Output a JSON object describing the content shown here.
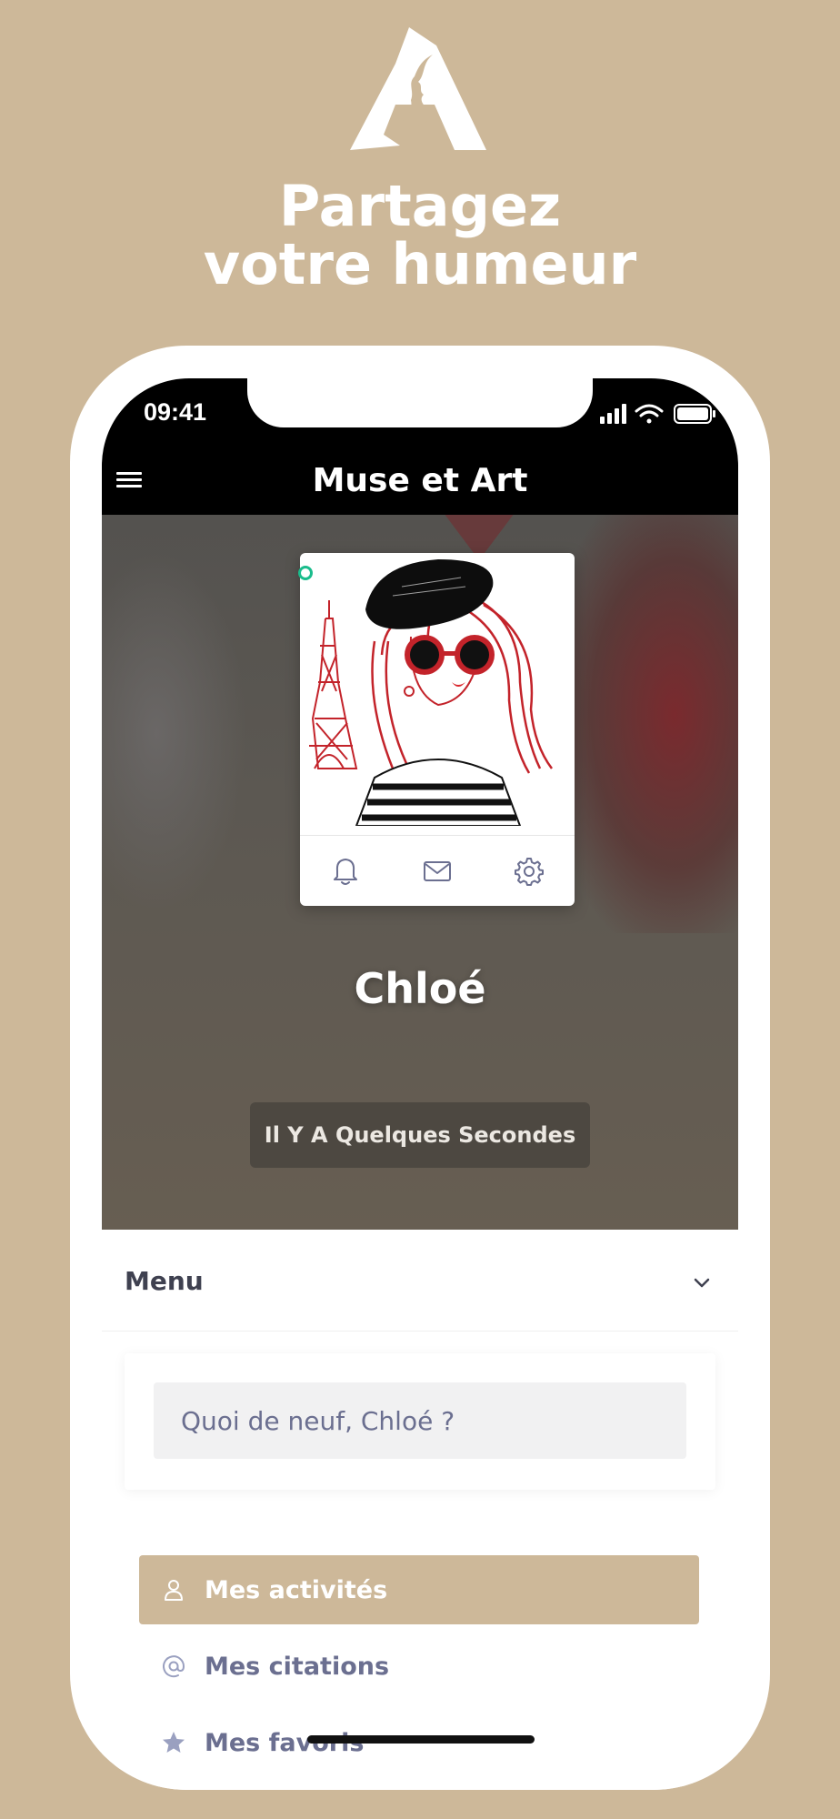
{
  "promo": {
    "headline_line1": "Partagez",
    "headline_line2": "votre humeur"
  },
  "status": {
    "time": "09:41"
  },
  "app": {
    "title": "Muse et Art"
  },
  "profile": {
    "name": "Chloé",
    "last_seen": "Il Y A Quelques Secondes",
    "online": true,
    "online_color": "#1abc8c"
  },
  "card_actions": [
    "bell-icon",
    "mail-icon",
    "gear-icon"
  ],
  "menu": {
    "title": "Menu"
  },
  "post": {
    "placeholder": "Quoi de neuf, Chloé ?"
  },
  "nav": {
    "items": [
      {
        "label": "Mes activités",
        "icon": "user-icon",
        "active": true
      },
      {
        "label": "Mes citations",
        "icon": "at-icon",
        "active": false
      },
      {
        "label": "Mes favoris",
        "icon": "star-icon",
        "active": false
      }
    ]
  },
  "colors": {
    "background": "#cdb899",
    "accent": "#cdb899",
    "muted_text": "#6b6f90",
    "header": "#000000"
  }
}
